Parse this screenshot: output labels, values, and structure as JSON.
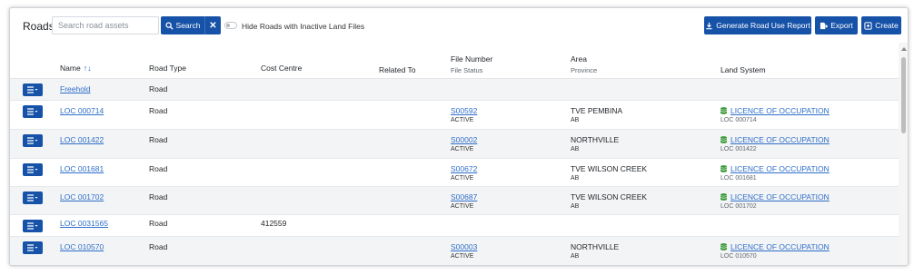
{
  "toolbar": {
    "title": "Roads",
    "search_placeholder": "Search road assets",
    "search_label": "Search",
    "clear_label": "✕",
    "toggle_label": "Hide Roads with Inactive Land Files",
    "report_label": "Generate Road Use Report",
    "export_label": "Export",
    "create_label": "Create"
  },
  "columns": {
    "name": "Name",
    "road_type": "Road Type",
    "cost_centre": "Cost Centre",
    "related_to": "Related To",
    "file_number": "File Number",
    "file_status": "File Status",
    "area": "Area",
    "province": "Province",
    "land_system": "Land System"
  },
  "rows": [
    {
      "name": "Freehold",
      "road_type": "Road",
      "cost_centre": "",
      "file_number": "",
      "file_status": "",
      "area": "",
      "province": "",
      "land_system": "",
      "land_sub": ""
    },
    {
      "name": "LOC 000714",
      "road_type": "Road",
      "cost_centre": "",
      "file_number": "S00592",
      "file_status": "ACTIVE",
      "area": "TVE PEMBINA",
      "province": "AB",
      "land_system": "LICENCE OF OCCUPATION",
      "land_sub": "LOC 000714"
    },
    {
      "name": "LOC 001422",
      "road_type": "Road",
      "cost_centre": "",
      "file_number": "S00002",
      "file_status": "ACTIVE",
      "area": "NORTHVILLE",
      "province": "AB",
      "land_system": "LICENCE OF OCCUPATION",
      "land_sub": "LOC 001422"
    },
    {
      "name": "LOC 001681",
      "road_type": "Road",
      "cost_centre": "",
      "file_number": "S00672",
      "file_status": "ACTIVE",
      "area": "TVE WILSON CREEK",
      "province": "AB",
      "land_system": "LICENCE OF OCCUPATION",
      "land_sub": "LOC 001681"
    },
    {
      "name": "LOC 001702",
      "road_type": "Road",
      "cost_centre": "",
      "file_number": "S00687",
      "file_status": "ACTIVE",
      "area": "TVE WILSON CREEK",
      "province": "AB",
      "land_system": "LICENCE OF OCCUPATION",
      "land_sub": "LOC 001702"
    },
    {
      "name": "LOC 0031565",
      "road_type": "Road",
      "cost_centre": "412559",
      "file_number": "",
      "file_status": "",
      "area": "",
      "province": "",
      "land_system": "",
      "land_sub": ""
    },
    {
      "name": "LOC 010570",
      "road_type": "Road",
      "cost_centre": "",
      "file_number": "S00003",
      "file_status": "ACTIVE",
      "area": "NORTHVILLE",
      "province": "AB",
      "land_system": "LICENCE OF OCCUPATION",
      "land_sub": "LOC 010570"
    }
  ],
  "colors": {
    "primary": "#1652a8",
    "link": "#2f6fc9",
    "land_icon": "#3a9a3a"
  },
  "icons": {
    "search": "search-icon",
    "menu": "menu-icon",
    "land": "database-icon",
    "download": "download-icon",
    "export": "export-icon",
    "create": "plus-square-icon"
  }
}
